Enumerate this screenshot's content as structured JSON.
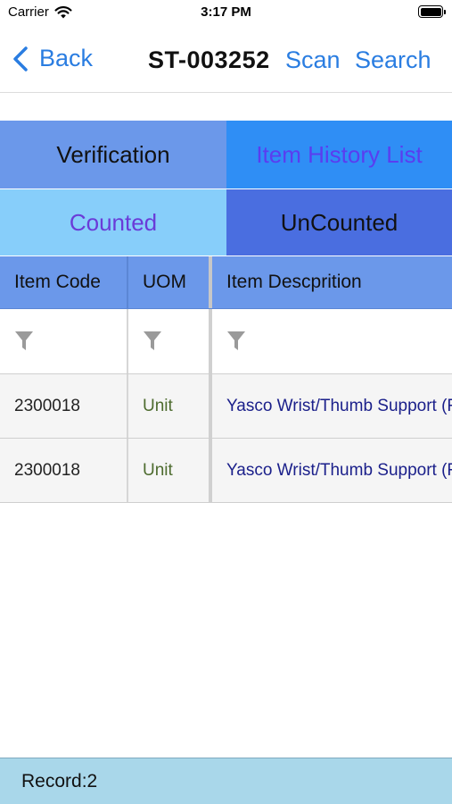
{
  "status_bar": {
    "carrier": "Carrier",
    "time": "3:17 PM",
    "wifi_icon": "wifi-icon",
    "battery_icon": "battery-icon"
  },
  "nav": {
    "back_label": "Back",
    "title": "ST-003252",
    "scan_label": "Scan",
    "search_label": "Search",
    "accent_color": "#2a7de1"
  },
  "tabs": {
    "verification": "Verification",
    "item_history": "Item History List",
    "counted": "Counted",
    "uncounted": "UnCounted"
  },
  "grid": {
    "columns": [
      "Item Code",
      "UOM",
      "Item Descprition"
    ],
    "filter_icon": "filter-icon",
    "rows": [
      {
        "code": "2300018",
        "uom": "Unit",
        "description": "Yasco Wrist/Thumb Support (R"
      },
      {
        "code": "2300018",
        "uom": "Unit",
        "description": "Yasco Wrist/Thumb Support (R"
      }
    ]
  },
  "footer": {
    "record_text": "Record:2"
  }
}
